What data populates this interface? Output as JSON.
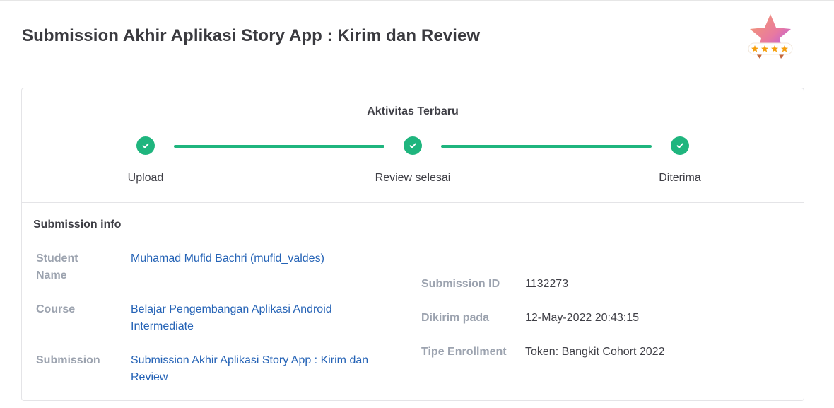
{
  "page": {
    "title": "Submission Akhir Aplikasi Story App : Kirim dan Review"
  },
  "activity": {
    "title": "Aktivitas Terbaru",
    "steps": [
      {
        "label": "Upload",
        "done": true
      },
      {
        "label": "Review selesai",
        "done": true
      },
      {
        "label": "Diterima",
        "done": true
      }
    ]
  },
  "colors": {
    "step_green": "#1fb57e",
    "link_blue": "#2563b6",
    "label_gray": "#9ca3af"
  },
  "submission_info": {
    "title": "Submission info",
    "student_name_label": "Student Name",
    "student_name_label_line1": "Student",
    "student_name_label_line2": "Name",
    "student_name": "Muhamad Mufid Bachri (mufid_valdes)",
    "course_label": "Course",
    "course_line1": "Belajar Pengembangan Aplikasi Android",
    "course_line2": "Intermediate",
    "submission_label": "Submission",
    "submission_line1": "Submission Akhir Aplikasi Story App : Kirim dan",
    "submission_line2": "Review",
    "submission_id_label": "Submission ID",
    "submission_id": "1132273",
    "sent_label": "Dikirim pada",
    "sent_at": "12-May-2022 20:43:15",
    "enrollment_label": "Tipe Enrollment",
    "enrollment": "Token: Bangkit Cohort 2022"
  },
  "badge": {
    "icon": "star-rating-badge-icon",
    "stars": 4
  }
}
